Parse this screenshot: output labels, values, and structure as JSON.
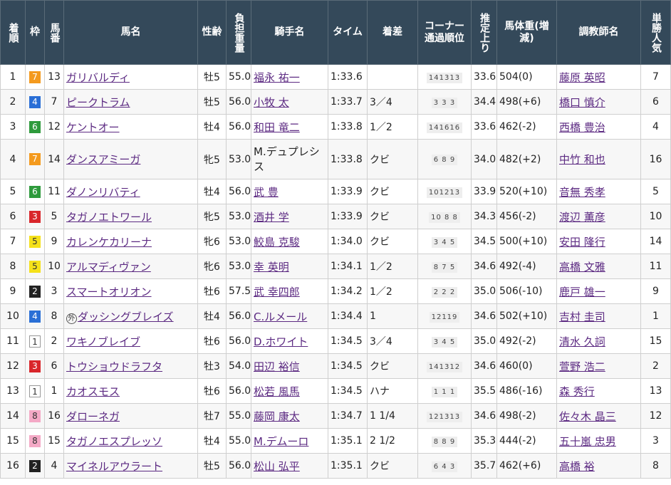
{
  "headers": {
    "rank": "着順",
    "frame": "枠",
    "num": "馬番",
    "horse": "馬名",
    "sexage": "性齢",
    "weight": "負担重量",
    "jockey": "騎手名",
    "time": "タイム",
    "margin": "着差",
    "corner": "コーナー通過順位",
    "last": "推定上り",
    "body": "馬体重(増減)",
    "trainer": "調教師名",
    "pop": "単勝人気"
  },
  "foreign_mark": "外",
  "rows": [
    {
      "rank": "1",
      "frame": "7",
      "num": "13",
      "horse": "ガリバルディ",
      "sexage": "牡5",
      "weight": "55.0",
      "jockey": "福永 祐一",
      "time": "1:33.6",
      "margin": "",
      "corner": "141313",
      "last": "33.6",
      "body": "504(0)",
      "trainer": "藤原 英昭",
      "pop": "7"
    },
    {
      "rank": "2",
      "frame": "4",
      "num": "7",
      "horse": "ピークトラム",
      "sexage": "牡5",
      "weight": "56.0",
      "jockey": "小牧 太",
      "time": "1:33.7",
      "margin": "3／4",
      "corner": "3 3 3",
      "last": "34.4",
      "body": "498(+6)",
      "trainer": "橋口 慎介",
      "pop": "6"
    },
    {
      "rank": "3",
      "frame": "6",
      "num": "12",
      "horse": "ケントオー",
      "sexage": "牡4",
      "weight": "56.0",
      "jockey": "和田 竜二",
      "time": "1:33.8",
      "margin": "1／2",
      "corner": "141616",
      "last": "33.6",
      "body": "462(-2)",
      "trainer": "西橋 豊治",
      "pop": "4"
    },
    {
      "rank": "4",
      "frame": "7",
      "num": "14",
      "horse": "ダンスアミーガ",
      "sexage": "牝5",
      "weight": "53.0",
      "jockey": "M.デュプレシス",
      "time": "1:33.8",
      "margin": "クビ",
      "corner": "6 8 9",
      "last": "34.0",
      "body": "482(+2)",
      "trainer": "中竹 和也",
      "pop": "16"
    },
    {
      "rank": "5",
      "frame": "6",
      "num": "11",
      "horse": "ダノンリバティ",
      "sexage": "牡4",
      "weight": "56.0",
      "jockey": "武 豊",
      "time": "1:33.9",
      "margin": "クビ",
      "corner": "101213",
      "last": "33.9",
      "body": "520(+10)",
      "trainer": "音無 秀孝",
      "pop": "5"
    },
    {
      "rank": "6",
      "frame": "3",
      "num": "5",
      "horse": "タガノエトワール",
      "sexage": "牝5",
      "weight": "53.0",
      "jockey": "酒井 学",
      "time": "1:33.9",
      "margin": "クビ",
      "corner": "10 8 8",
      "last": "34.3",
      "body": "456(-2)",
      "trainer": "渡辺 薫彦",
      "pop": "10"
    },
    {
      "rank": "7",
      "frame": "5",
      "num": "9",
      "horse": "カレンケカリーナ",
      "sexage": "牝6",
      "weight": "53.0",
      "jockey": "鮫島 克駿",
      "time": "1:34.0",
      "margin": "クビ",
      "corner": "3 4 5",
      "last": "34.5",
      "body": "500(+10)",
      "trainer": "安田 隆行",
      "pop": "14"
    },
    {
      "rank": "8",
      "frame": "5",
      "num": "10",
      "horse": "アルマディヴァン",
      "sexage": "牝6",
      "weight": "53.0",
      "jockey": "幸 英明",
      "time": "1:34.1",
      "margin": "1／2",
      "corner": "8 7 5",
      "last": "34.6",
      "body": "492(-4)",
      "trainer": "高橋 文雅",
      "pop": "11"
    },
    {
      "rank": "9",
      "frame": "2",
      "num": "3",
      "horse": "スマートオリオン",
      "sexage": "牡6",
      "weight": "57.5",
      "jockey": "武 幸四郎",
      "time": "1:34.2",
      "margin": "1／2",
      "corner": "2 2 2",
      "last": "35.0",
      "body": "506(-10)",
      "trainer": "鹿戸 雄一",
      "pop": "9"
    },
    {
      "rank": "10",
      "frame": "4",
      "num": "8",
      "horse": "ダッシングブレイズ",
      "foreign": true,
      "sexage": "牡4",
      "weight": "56.0",
      "jockey": "C.ルメール",
      "time": "1:34.4",
      "margin": "1",
      "corner": "12119",
      "last": "34.6",
      "body": "502(+10)",
      "trainer": "吉村 圭司",
      "pop": "1"
    },
    {
      "rank": "11",
      "frame": "1",
      "num": "2",
      "horse": "ワキノブレイブ",
      "sexage": "牡6",
      "weight": "56.0",
      "jockey": "D.ホワイト",
      "time": "1:34.5",
      "margin": "3／4",
      "corner": "3 4 5",
      "last": "35.0",
      "body": "492(-2)",
      "trainer": "清水 久詞",
      "pop": "15"
    },
    {
      "rank": "12",
      "frame": "3",
      "num": "6",
      "horse": "トウショウドラフタ",
      "sexage": "牡3",
      "weight": "54.0",
      "jockey": "田辺 裕信",
      "time": "1:34.5",
      "margin": "クビ",
      "corner": "141312",
      "last": "34.6",
      "body": "460(0)",
      "trainer": "萱野 浩二",
      "pop": "2"
    },
    {
      "rank": "13",
      "frame": "1",
      "num": "1",
      "horse": "カオスモス",
      "sexage": "牡6",
      "weight": "56.0",
      "jockey": "松若 風馬",
      "time": "1:34.5",
      "margin": "ハナ",
      "corner": "1 1 1",
      "last": "35.5",
      "body": "486(-16)",
      "trainer": "森 秀行",
      "pop": "13"
    },
    {
      "rank": "14",
      "frame": "8",
      "num": "16",
      "horse": "ダローネガ",
      "sexage": "牡7",
      "weight": "55.0",
      "jockey": "藤岡 康太",
      "time": "1:34.7",
      "margin": "1 1/4",
      "corner": "121313",
      "last": "34.6",
      "body": "498(-2)",
      "trainer": "佐々木 晶三",
      "pop": "12"
    },
    {
      "rank": "15",
      "frame": "8",
      "num": "15",
      "horse": "タガノエスプレッソ",
      "sexage": "牡4",
      "weight": "55.0",
      "jockey": "M.デムーロ",
      "time": "1:35.1",
      "margin": "2 1/2",
      "corner": "8 8 9",
      "last": "35.3",
      "body": "444(-2)",
      "trainer": "五十嵐 忠男",
      "pop": "3"
    },
    {
      "rank": "16",
      "frame": "2",
      "num": "4",
      "horse": "マイネルアウラート",
      "sexage": "牡5",
      "weight": "56.0",
      "jockey": "松山 弘平",
      "time": "1:35.1",
      "margin": "クビ",
      "corner": "6 4 3",
      "last": "35.7",
      "body": "462(+6)",
      "trainer": "高橋 裕",
      "pop": "8"
    }
  ]
}
